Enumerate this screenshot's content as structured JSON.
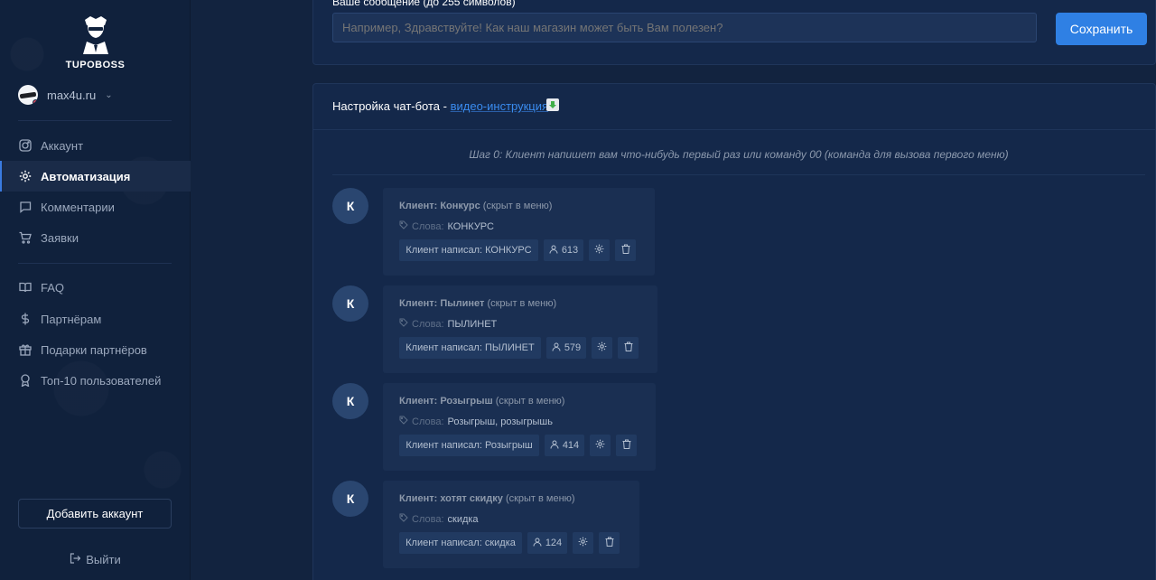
{
  "sidebar": {
    "logo_text": "TUPOBOSS",
    "account_name": "max4u.ru",
    "nav": [
      {
        "label": "Аккаунт",
        "icon": "instagram-icon"
      },
      {
        "label": "Автоматизация",
        "icon": "gear-icon",
        "active": true
      },
      {
        "label": "Комментарии",
        "icon": "comment-icon"
      },
      {
        "label": "Заявки",
        "icon": "cart-icon"
      }
    ],
    "nav2": [
      {
        "label": "FAQ",
        "icon": "book-icon"
      },
      {
        "label": "Партнёрам",
        "icon": "dollar-icon"
      },
      {
        "label": "Подарки партнёров",
        "icon": "gift-icon"
      },
      {
        "label": "Топ-10 пользователей",
        "icon": "award-icon"
      }
    ],
    "add_account_label": "Добавить аккаунт",
    "logout_label": "Выйти"
  },
  "message": {
    "label": "Ваше сообщение (до 255 символов)",
    "placeholder": "Например, Здравствуйте! Как наш магазин может быть Вам полезен?",
    "save_label": "Сохранить"
  },
  "chatbot": {
    "title": "Настройка чат-бота - ",
    "link": "видео-инструкция",
    "step_text": "Шаг 0: Клиент напишет вам что-нибудь первый раз или команду 00 (команда для вызова первого меню)",
    "words_label": "Слова:",
    "items": [
      {
        "avatar": "К",
        "title": "Клиент: Конкурс",
        "hidden": "(скрыт в меню)",
        "words": "КОНКУРС",
        "chip": "Клиент написал: КОНКУРС",
        "count": "613"
      },
      {
        "avatar": "К",
        "title": "Клиент: Пылинет",
        "hidden": "(скрыт в меню)",
        "words": "ПЫЛИНЕТ",
        "chip": "Клиент написал: ПЫЛИНЕТ",
        "count": "579"
      },
      {
        "avatar": "К",
        "title": "Клиент: Розыгрыш",
        "hidden": "(скрыт в меню)",
        "words": "Розыгрыш, розыгрышь",
        "chip": "Клиент написал: Розыгрыш",
        "count": "414"
      },
      {
        "avatar": "К",
        "title": "Клиент: хотят скидку",
        "hidden": "(скрыт в меню)",
        "words": "скидка",
        "chip": "Клиент написал: скидка",
        "count": "124"
      }
    ]
  },
  "colors": {
    "accent": "#2f80e4",
    "sidebar_bg": "#10213c",
    "main_bg": "#12233f"
  }
}
